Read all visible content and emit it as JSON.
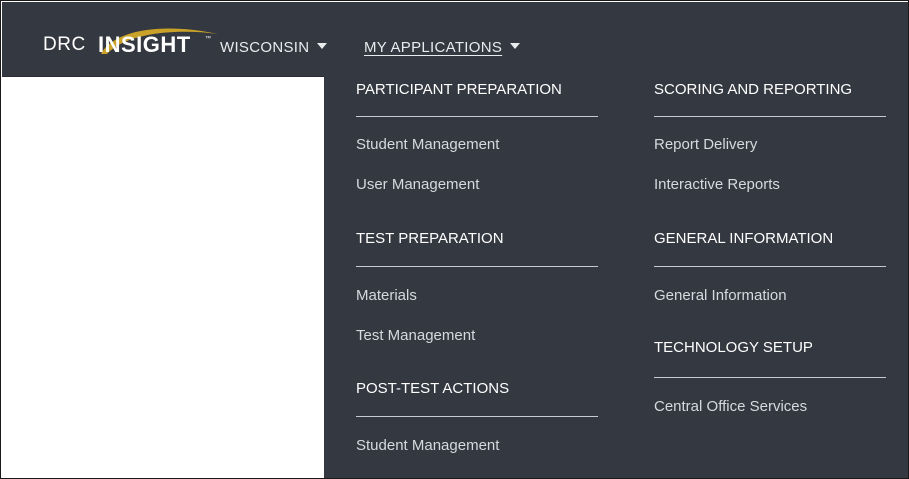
{
  "header": {
    "logo_drc": "DRC",
    "logo_insight": "INSIGHT",
    "logo_tm": "™",
    "state_label": "WISCONSIN",
    "apps_label": "MY APPLICATIONS"
  },
  "menu": {
    "participant_preparation": {
      "title": "PARTICIPANT PREPARATION",
      "items": [
        "Student Management",
        "User Management"
      ]
    },
    "test_preparation": {
      "title": "TEST PREPARATION",
      "items": [
        "Materials",
        "Test Management"
      ]
    },
    "post_test_actions": {
      "title": "POST-TEST ACTIONS",
      "items": [
        "Student Management"
      ]
    },
    "scoring_and_reporting": {
      "title": "SCORING AND REPORTING",
      "items": [
        "Report Delivery",
        "Interactive Reports"
      ]
    },
    "general_information": {
      "title": "GENERAL INFORMATION",
      "items": [
        "General Information"
      ]
    },
    "technology_setup": {
      "title": "TECHNOLOGY SETUP",
      "items": [
        "Central Office Services"
      ]
    }
  },
  "colors": {
    "bar": "#343840",
    "logo_swoosh": "#c9a227",
    "text": "#ffffff",
    "item_text": "#d6d9de"
  },
  "icons": {
    "caret": "chevron-down-icon",
    "logo": "drc-insight-logo"
  }
}
